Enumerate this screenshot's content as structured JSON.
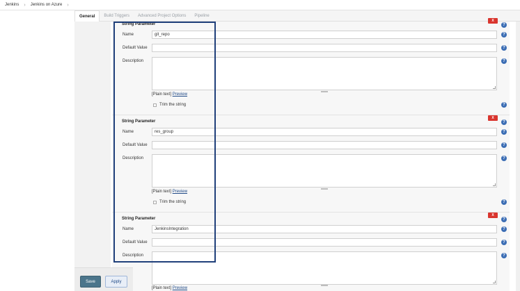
{
  "breadcrumb": {
    "items": [
      "Jenkins",
      "Jenkins on Azure"
    ],
    "sep": "›"
  },
  "tabs": [
    "General",
    "Build Triggers",
    "Advanced Project Options",
    "Pipeline"
  ],
  "labels": {
    "name": "Name",
    "default_value": "Default Value",
    "description": "Description",
    "trim": "Trim the string"
  },
  "help_glyph": "?",
  "delete_glyph": "X",
  "format": {
    "plain": "[Plain text]",
    "preview": "Preview"
  },
  "params": [
    {
      "heading": "String Parameter",
      "name": "git_repo",
      "default": ""
    },
    {
      "heading": "String Parameter",
      "name": "res_group",
      "default": ""
    },
    {
      "heading": "String Parameter",
      "name": "JenkinsIntegration",
      "default": ""
    }
  ],
  "buttons": {
    "save": "Save",
    "apply": "Apply"
  },
  "colors": {
    "highlight": "#1f3f7a",
    "delete": "#d9352e",
    "help": "#3b6db4",
    "save": "#4b758b"
  }
}
